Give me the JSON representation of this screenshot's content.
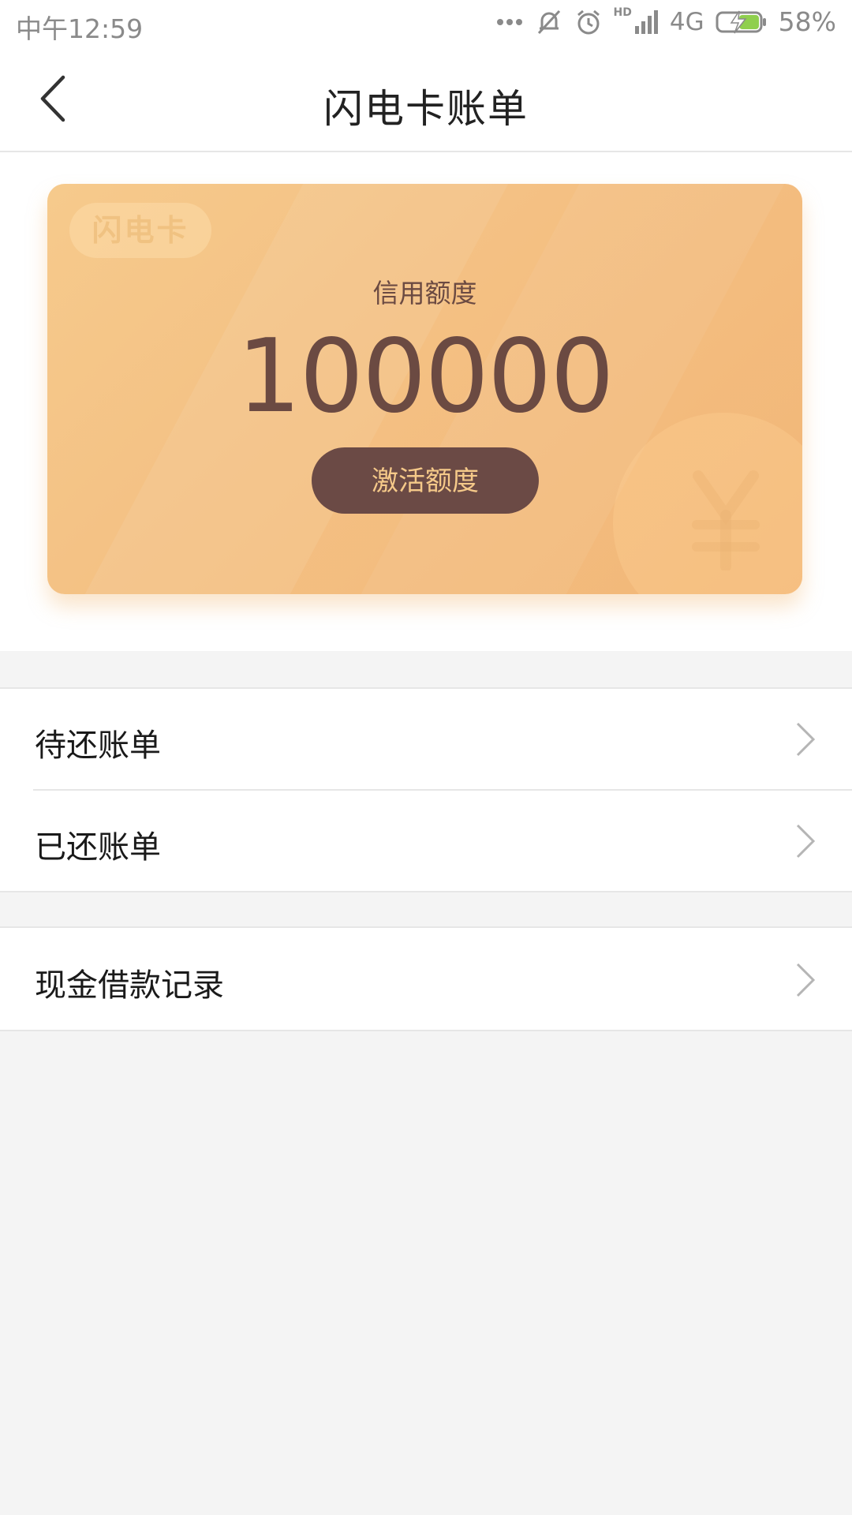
{
  "status_bar": {
    "time": "中午12:59",
    "network": "4G",
    "hd": "HD",
    "battery": "58%"
  },
  "header": {
    "title": "闪电卡账单"
  },
  "card": {
    "tag": "闪电卡",
    "credit_label": "信用额度",
    "credit_amount": "100000",
    "activate_label": "激活额度",
    "colors": {
      "gradient_start": "#f6ca8c",
      "gradient_end": "#f2b677",
      "button_bg": "#6b4a45",
      "button_text": "#f5c989",
      "text": "#6b4a42"
    }
  },
  "bills": {
    "items": [
      {
        "label": "待还账单",
        "icon": "chevron-right-icon"
      },
      {
        "label": "已还账单",
        "icon": "chevron-right-icon"
      }
    ]
  },
  "loans": {
    "items": [
      {
        "label": "现金借款记录",
        "icon": "chevron-right-icon"
      }
    ]
  }
}
